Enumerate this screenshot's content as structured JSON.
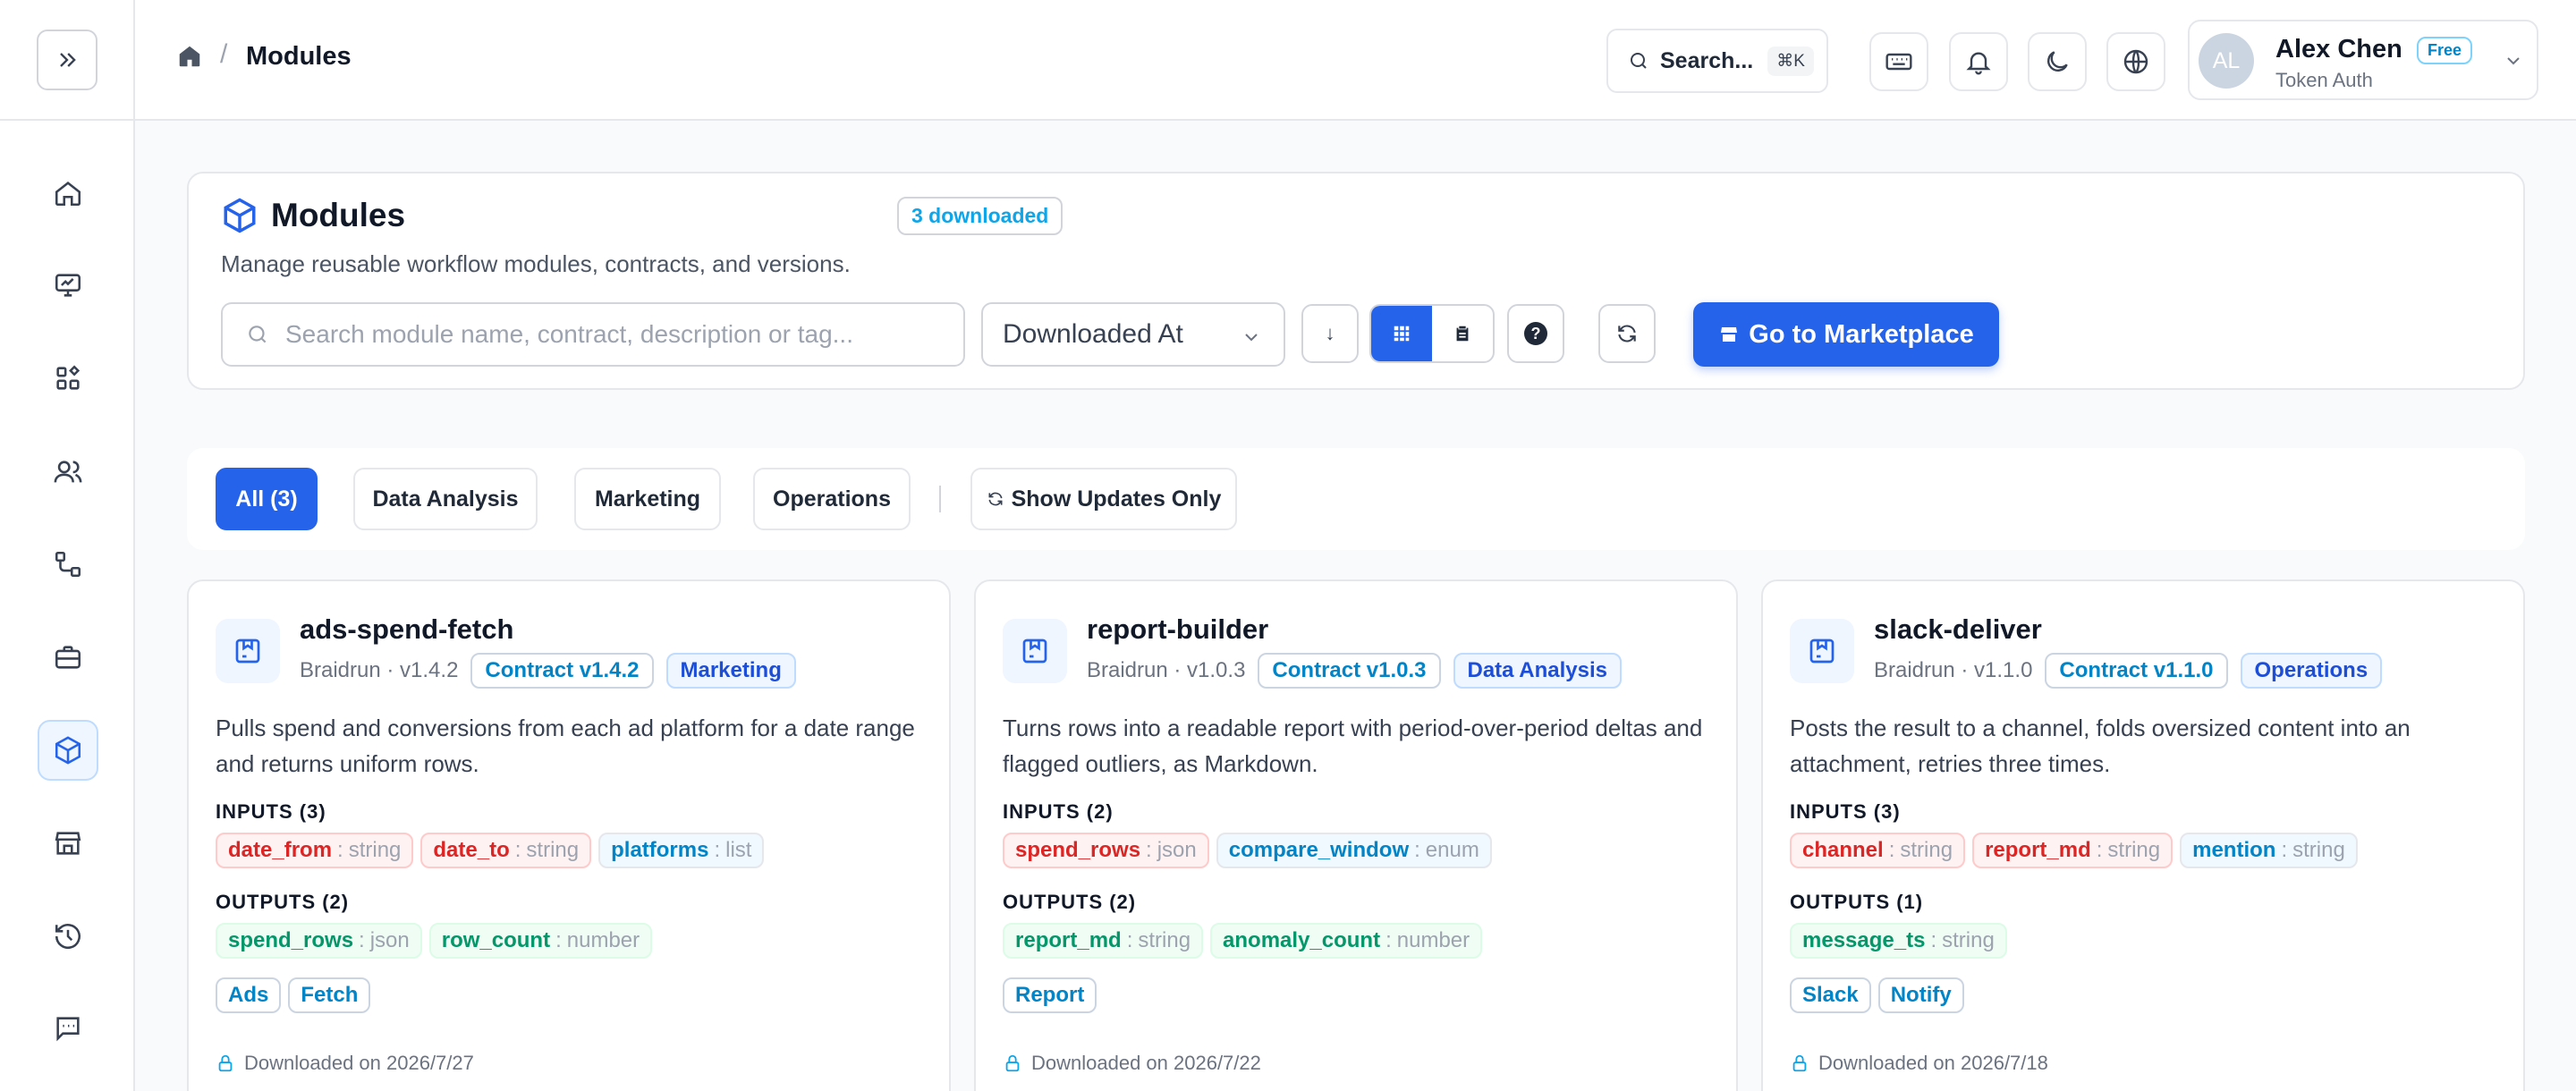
{
  "breadcrumb": {
    "current": "Modules"
  },
  "topbar": {
    "search_label": "Search...",
    "search_shortcut": "⌘K",
    "user": {
      "initials": "AL",
      "name": "Alex Chen",
      "plan": "Free",
      "auth": "Token Auth"
    }
  },
  "header": {
    "title": "Modules",
    "downloaded_badge": "3 downloaded",
    "description": "Manage reusable workflow modules, contracts, and versions.",
    "search_placeholder": "Search module name, contract, description or tag...",
    "sort_value": "Downloaded At",
    "marketplace_label": "Go to Marketplace",
    "sort_direction_glyph": "↓",
    "help_glyph": "?"
  },
  "filters": {
    "all": "All (3)",
    "data_analysis": "Data Analysis",
    "marketing": "Marketing",
    "operations": "Operations",
    "updates_only": "Show Updates Only"
  },
  "labels": {
    "inputs_prefix": "INPUTS",
    "outputs_prefix": "OUTPUTS"
  },
  "modules": [
    {
      "name": "ads-spend-fetch",
      "author_version": "Braidrun · v1.4.2",
      "contract": "Contract v1.4.2",
      "category": "Marketing",
      "description": "Pulls spend and conversions from each ad platform for a date range and returns uniform rows.",
      "inputs_label": "INPUTS (3)",
      "inputs": [
        {
          "name": "date_from",
          "type": "string",
          "style": "red"
        },
        {
          "name": "date_to",
          "type": "string",
          "style": "red"
        },
        {
          "name": "platforms",
          "type": "list",
          "style": "blue"
        }
      ],
      "outputs_label": "OUTPUTS (2)",
      "outputs": [
        {
          "name": "spend_rows",
          "type": "json"
        },
        {
          "name": "row_count",
          "type": "number"
        }
      ],
      "tags": [
        "Ads",
        "Fetch"
      ],
      "downloaded": "Downloaded on 2026/7/27"
    },
    {
      "name": "report-builder",
      "author_version": "Braidrun · v1.0.3",
      "contract": "Contract v1.0.3",
      "category": "Data Analysis",
      "description": "Turns rows into a readable report with period-over-period deltas and flagged outliers, as Markdown.",
      "inputs_label": "INPUTS (2)",
      "inputs": [
        {
          "name": "spend_rows",
          "type": "json",
          "style": "red"
        },
        {
          "name": "compare_window",
          "type": "enum",
          "style": "blue"
        }
      ],
      "outputs_label": "OUTPUTS (2)",
      "outputs": [
        {
          "name": "report_md",
          "type": "string"
        },
        {
          "name": "anomaly_count",
          "type": "number"
        }
      ],
      "tags": [
        "Report"
      ],
      "downloaded": "Downloaded on 2026/7/22"
    },
    {
      "name": "slack-deliver",
      "author_version": "Braidrun · v1.1.0",
      "contract": "Contract v1.1.0",
      "category": "Operations",
      "description": "Posts the result to a channel, folds oversized content into an attachment, retries three times.",
      "inputs_label": "INPUTS (3)",
      "inputs": [
        {
          "name": "channel",
          "type": "string",
          "style": "red"
        },
        {
          "name": "report_md",
          "type": "string",
          "style": "red"
        },
        {
          "name": "mention",
          "type": "string",
          "style": "blue"
        }
      ],
      "outputs_label": "OUTPUTS (1)",
      "outputs": [
        {
          "name": "message_ts",
          "type": "string"
        }
      ],
      "tags": [
        "Slack",
        "Notify"
      ],
      "downloaded": "Downloaded on 2026/7/18"
    }
  ],
  "colors": {
    "accent": "#2563eb",
    "required": "#dc2626",
    "optional": "#0284c7",
    "output": "#059669"
  }
}
